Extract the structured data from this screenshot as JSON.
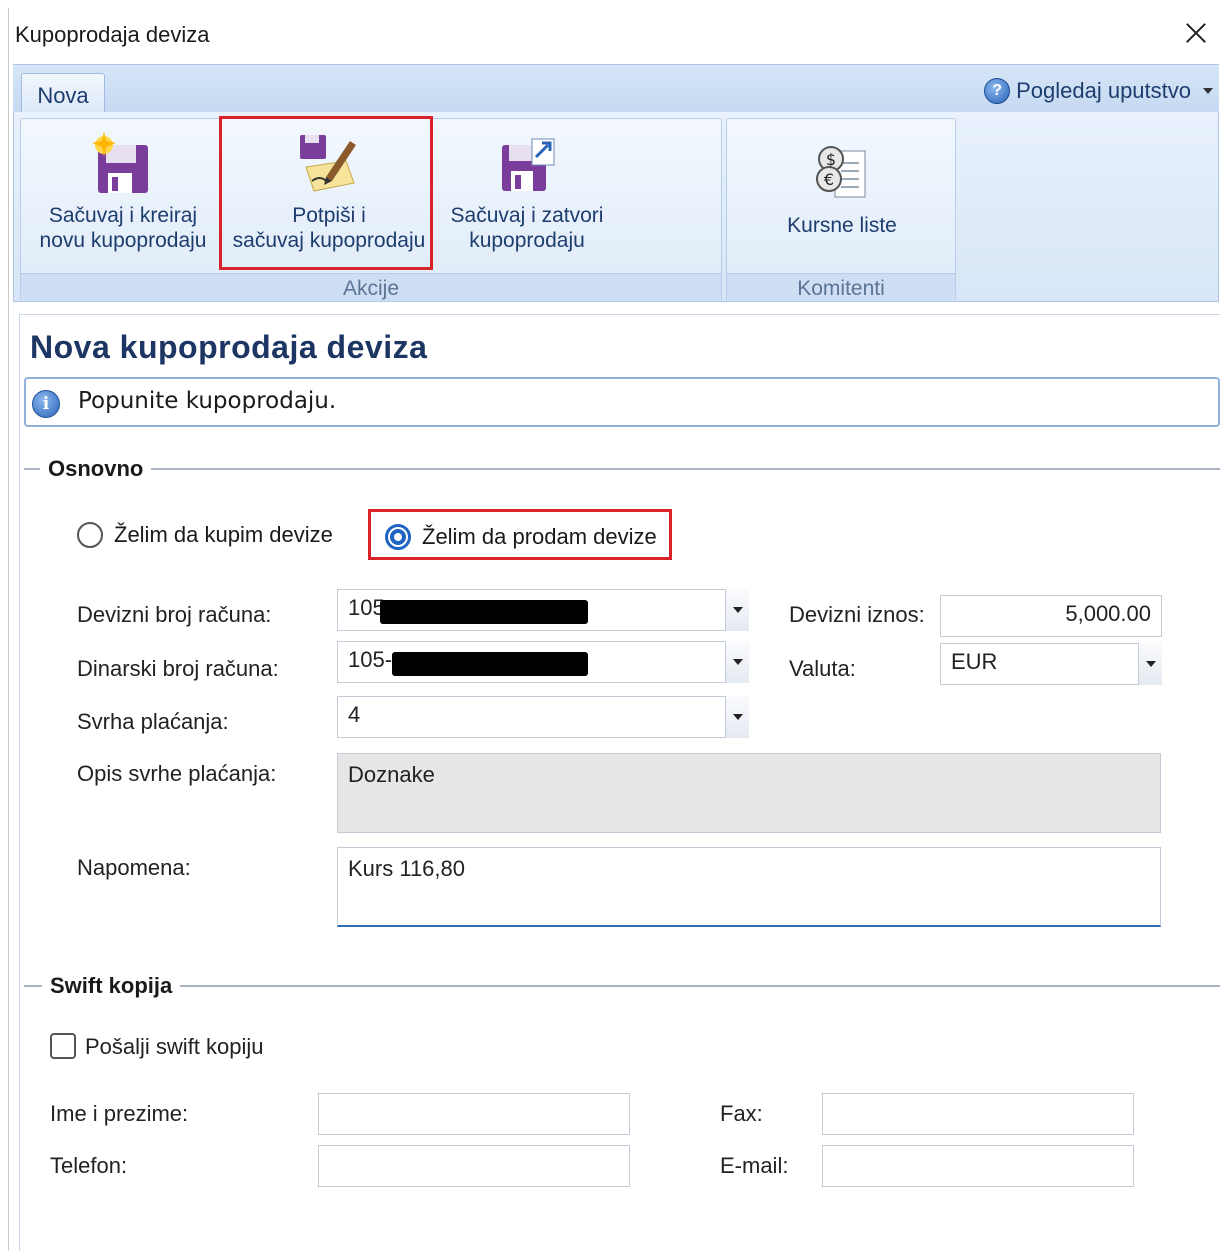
{
  "window": {
    "title": "Kupoprodaja deviza"
  },
  "ribbon": {
    "tab": "Nova",
    "help": "Pogledaj uputstvo",
    "groups": [
      {
        "label": "Akcije",
        "buttons": [
          "Sačuvaj i kreiraj novu kupoprodaju",
          "Potpiši i sačuvaj kupoprodaju",
          "Sačuvaj i zatvori kupoprodaju"
        ]
      },
      {
        "label": "Komitenti",
        "buttons": [
          "Kursne liste"
        ]
      }
    ],
    "btn1_line1": "Sačuvaj i kreiraj",
    "btn1_line2": "novu kupoprodaju",
    "btn2_line1": "Potpiši i",
    "btn2_line2": "sačuvaj kupoprodaju",
    "btn3_line1": "Sačuvaj i zatvori",
    "btn3_line2": "kupoprodaju",
    "btn4": "Kursne liste",
    "group1": "Akcije",
    "group2": "Komitenti"
  },
  "page": {
    "title": "Nova kupoprodaja deviza",
    "info": "Popunite kupoprodaju."
  },
  "osnovno": {
    "title": "Osnovno",
    "radio_buy": "Želim da kupim devize",
    "radio_sell": "Želim da prodam devize",
    "selected": "sell",
    "devizni_label": "Devizni broj računa:",
    "devizni_value": "105",
    "dinarski_label": "Dinarski broj računa:",
    "dinarski_value": "105-",
    "svrha_label": "Svrha plaćanja:",
    "svrha_value": "4",
    "opis_label": "Opis svrhe plaćanja:",
    "opis_value": "Doznake",
    "napomena_label": "Napomena:",
    "napomena_value": "Kurs 116,80",
    "iznos_label": "Devizni iznos:",
    "iznos_value": "5,000.00",
    "valuta_label": "Valuta:",
    "valuta_value": "EUR"
  },
  "swift": {
    "title": "Swift kopija",
    "checkbox": "Pošalji swift kopiju",
    "ime_label": "Ime i prezime:",
    "telefon_label": "Telefon:",
    "fax_label": "Fax:",
    "email_label": "E-mail:"
  },
  "colors": {
    "highlight": "#d8232a",
    "title": "#1c3563",
    "ribbon": "#d8e6f7"
  }
}
